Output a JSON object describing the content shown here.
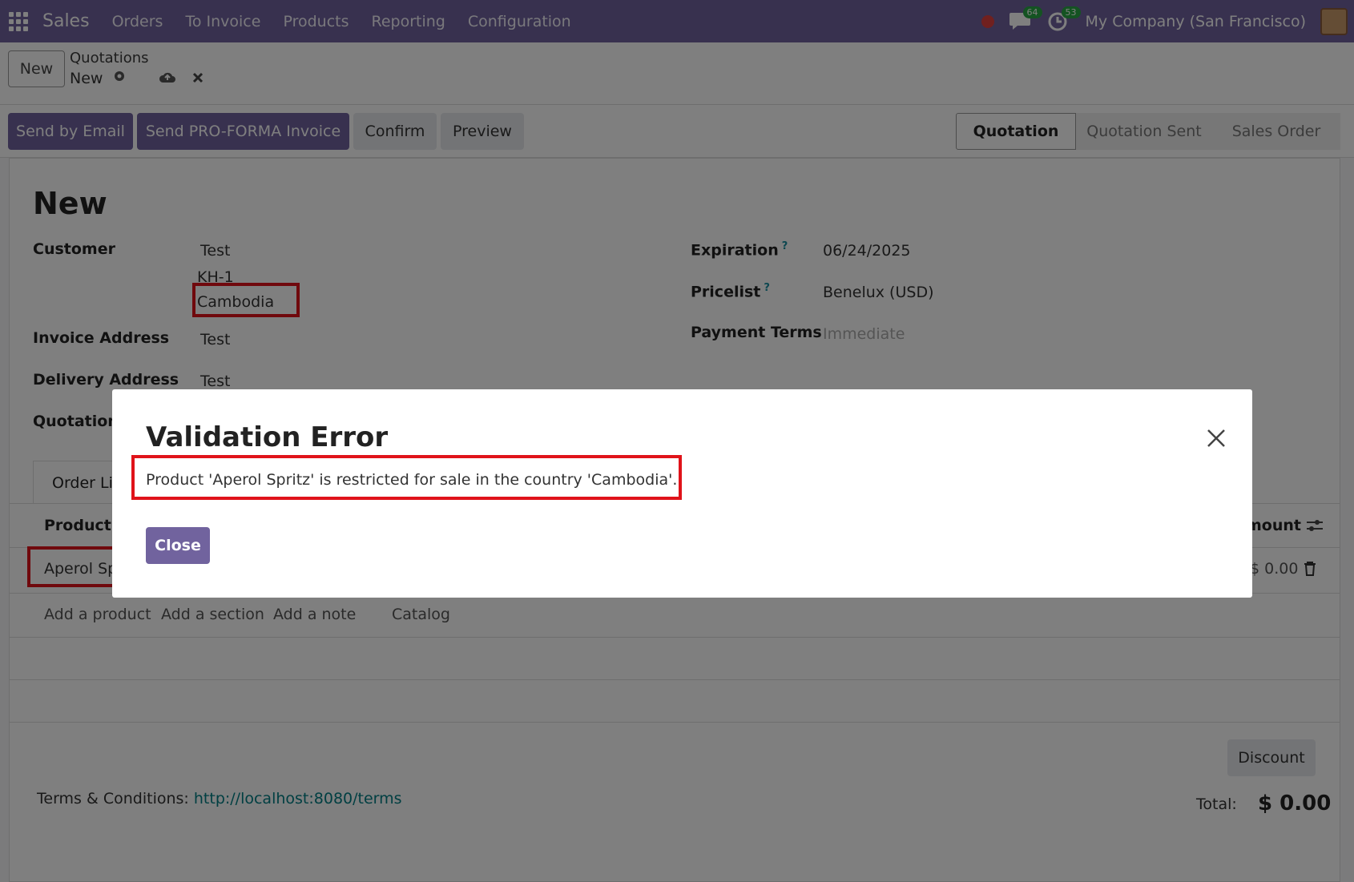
{
  "nav": {
    "app_name": "Sales",
    "menu": [
      "Orders",
      "To Invoice",
      "Products",
      "Reporting",
      "Configuration"
    ],
    "messages_count": "64",
    "activities_count": "53",
    "company": "My Company (San Francisco)"
  },
  "control_panel": {
    "new_label": "New",
    "breadcrumb_parent": "Quotations",
    "breadcrumb_current": "New"
  },
  "statusbar": {
    "send_email": "Send by Email",
    "send_proforma": "Send PRO-FORMA Invoice",
    "confirm": "Confirm",
    "preview": "Preview",
    "stages": [
      "Quotation",
      "Quotation Sent",
      "Sales Order"
    ]
  },
  "form": {
    "title": "New",
    "customer_label": "Customer",
    "customer_name": "Test",
    "customer_line2": "KH-1",
    "customer_country": "Cambodia",
    "invoice_label": "Invoice Address",
    "invoice_value": "Test",
    "delivery_label": "Delivery Address",
    "delivery_value": "Test",
    "quotation_label": "Quotation",
    "expiration_label": "Expiration",
    "expiration_value": "06/24/2025",
    "pricelist_label": "Pricelist",
    "pricelist_value": "Benelux (USD)",
    "payment_label": "Payment Terms",
    "payment_placeholder": "Immediate",
    "help_mark": "?"
  },
  "lines": {
    "tab_label": "Order Li",
    "col_product": "Product",
    "col_amount": "mount",
    "row_product": "Aperol Sp",
    "row_amount": "$ 0.00",
    "add_product": "Add a product",
    "add_section": "Add a section",
    "add_note": "Add a note",
    "catalog": "Catalog"
  },
  "footer": {
    "terms_label": "Terms & Conditions:",
    "terms_link": "http://localhost:8080/terms",
    "discount": "Discount",
    "total_label": "Total:",
    "total_value": "$ 0.00"
  },
  "dialog": {
    "title": "Validation Error",
    "message": "Product 'Aperol Spritz' is restricted for sale in the country 'Cambodia'.",
    "close_label": "Close"
  },
  "colors": {
    "brand": "#71639e",
    "highlight": "#e0131a",
    "link": "#017e84"
  }
}
